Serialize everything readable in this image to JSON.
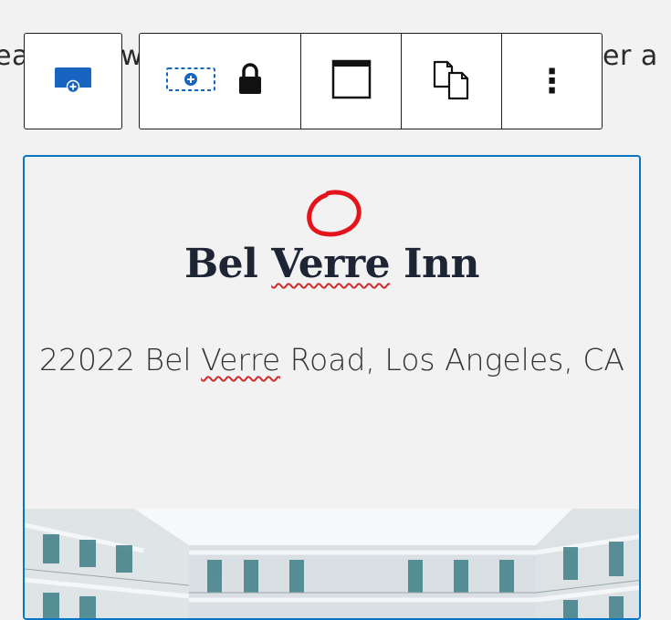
{
  "background_text": {
    "left": "ea",
    "mid": "w",
    "right": "er a"
  },
  "toolbar": {
    "buttons": [
      {
        "name": "block-type-icon",
        "label": "Cover block"
      },
      {
        "name": "add-inner-block-icon",
        "label": "Select parent / inner block"
      },
      {
        "name": "lock-icon",
        "label": "Lock"
      },
      {
        "name": "full-height-icon",
        "label": "Toggle full height"
      },
      {
        "name": "duplicate-icon",
        "label": "Duplicate"
      },
      {
        "name": "more-options-icon",
        "label": "⋮"
      }
    ]
  },
  "block": {
    "title": "Bel Verre Inn",
    "title_parts": [
      "Bel ",
      "Verre",
      " Inn"
    ],
    "address_parts": [
      "22022 Bel ",
      "Verre",
      " Road, Los Angeles, CA"
    ]
  },
  "colors": {
    "accent": "#0675c4",
    "misspell": "#d12b2b",
    "annotation": "#e3141b",
    "title": "#1d2433"
  }
}
